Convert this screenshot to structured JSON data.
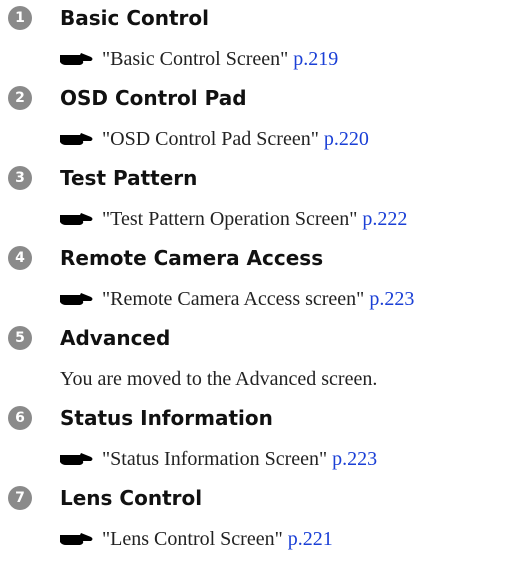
{
  "entries": [
    {
      "number": "1",
      "title": "Basic Control",
      "ref_text": "\"Basic Control Screen\"",
      "page": "p.219"
    },
    {
      "number": "2",
      "title": "OSD Control Pad",
      "ref_text": "\"OSD Control Pad Screen\"",
      "page": "p.220"
    },
    {
      "number": "3",
      "title": "Test Pattern",
      "ref_text": "\"Test Pattern Operation Screen\"",
      "page": "p.222"
    },
    {
      "number": "4",
      "title": "Remote Camera Access",
      "ref_text": "\"Remote Camera Access screen\"",
      "page": "p.223"
    },
    {
      "number": "5",
      "title": "Advanced",
      "description": "You are moved to the Advanced screen."
    },
    {
      "number": "6",
      "title": "Status Information",
      "ref_text": "\"Status Information Screen\"",
      "page": "p.223"
    },
    {
      "number": "7",
      "title": "Lens Control",
      "ref_text": "\"Lens Control Screen\"",
      "page": "p.221"
    }
  ],
  "icons": {
    "reference": "pointing-hand-icon",
    "number_badge_color": "#8a8a8a",
    "link_color": "#1a3fd6"
  }
}
